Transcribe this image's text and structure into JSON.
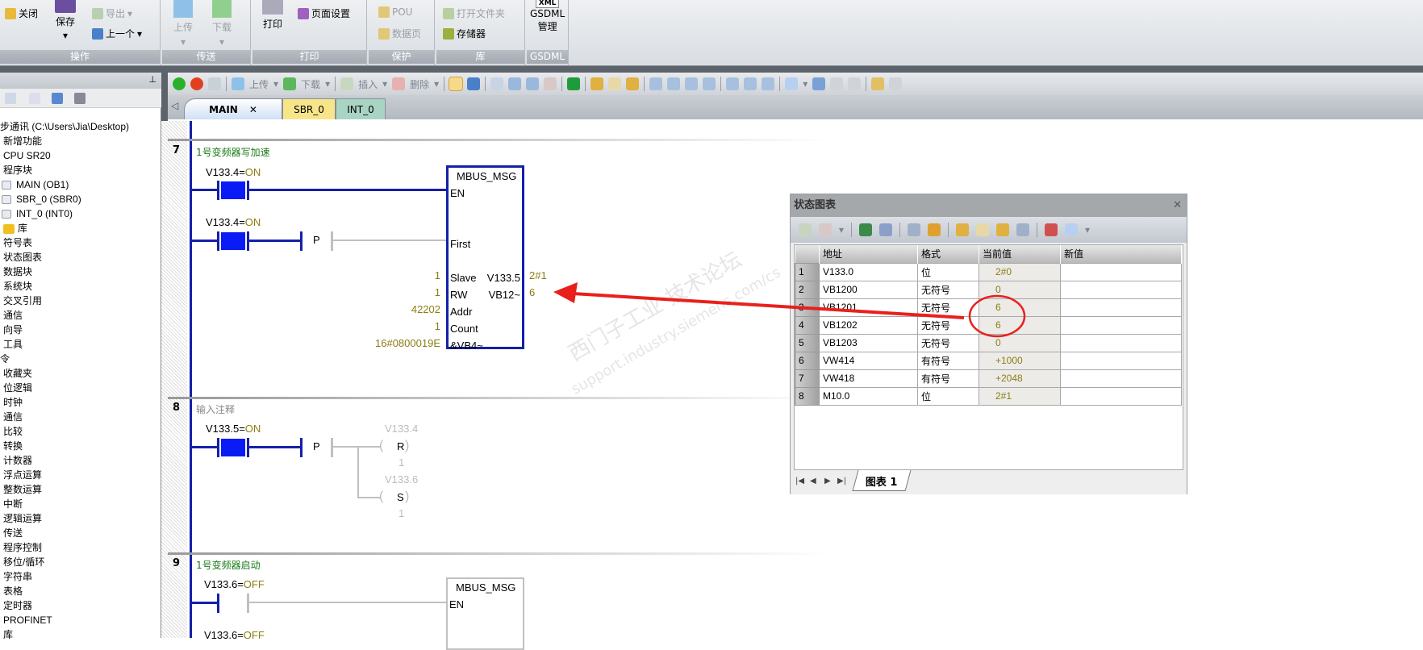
{
  "ribbon": {
    "groups": [
      {
        "label": "操作"
      },
      {
        "label": "传送"
      },
      {
        "label": "打印"
      },
      {
        "label": "保护"
      },
      {
        "label": "库"
      },
      {
        "label": "GSDML"
      }
    ],
    "close": "关闭",
    "save": "保存",
    "export": "导出",
    "previous": "上一个",
    "upload": "上传",
    "download": "下载",
    "print": "打印",
    "page_setup": "页面设置",
    "pou": "POU",
    "data_page": "数据页",
    "open_folder": "打开文件夹",
    "memory": "存储器",
    "gsdml_icon": "XML",
    "gsdml_line1": "GSDML",
    "gsdml_line2": "管理"
  },
  "project_tree": {
    "items": [
      "步通讯 (C:\\Users\\Jia\\Desktop)",
      "新增功能",
      "CPU SR20",
      "程序块",
      "MAIN (OB1)",
      "SBR_0 (SBR0)",
      "INT_0 (INT0)",
      "库",
      "符号表",
      "状态图表",
      "数据块",
      "系统块",
      "交叉引用",
      "通信",
      "向导",
      "工具",
      "令",
      "收藏夹",
      "位逻辑",
      "时钟",
      "通信",
      "比较",
      "转换",
      "计数器",
      "浮点运算",
      "整数运算",
      "中断",
      "逻辑运算",
      "传送",
      "程序控制",
      "移位/循环",
      "字符串",
      "表格",
      "定时器",
      "PROFINET",
      "库"
    ]
  },
  "editor_toolbar": {
    "upload": "上传",
    "download": "下载",
    "insert": "插入",
    "delete": "删除"
  },
  "tabs": [
    {
      "label": "MAIN",
      "active": true,
      "color": "#cfe0f5"
    },
    {
      "label": "SBR_0",
      "color": "#f7e58a"
    },
    {
      "label": "INT_0",
      "color": "#a9d4c4"
    }
  ],
  "networks": [
    {
      "number": "7",
      "comment": "1号变频器写加速",
      "contact1": {
        "addr": "V133.4=",
        "state": "ON"
      },
      "contact2": {
        "addr": "V133.4=",
        "state": "ON"
      },
      "edge": "P",
      "box": {
        "name": "MBUS_MSG",
        "pins": [
          "EN",
          "First",
          "Slave",
          "RW",
          "Addr",
          "Count",
          "&VB4~"
        ],
        "inputs": [
          "1",
          "1",
          "42202",
          "1",
          "16#0800019E"
        ],
        "outputs": [
          {
            "pin": "V133.5",
            "value": "2#1"
          },
          {
            "pin": "VB12~",
            "value": "6"
          }
        ]
      }
    },
    {
      "number": "8",
      "comment": "输入注释",
      "contact1": {
        "addr": "V133.5=",
        "state": "ON"
      },
      "edge": "P",
      "coils": [
        {
          "addr": "V133.4",
          "type": "R",
          "n": "1"
        },
        {
          "addr": "V133.6",
          "type": "S",
          "n": "1"
        }
      ]
    },
    {
      "number": "9",
      "comment": "1号变频器启动",
      "contact1": {
        "addr": "V133.6=",
        "state": "OFF"
      },
      "contact2": {
        "addr": "V133.6=",
        "state": "OFF"
      },
      "box": {
        "name": "MBUS_MSG",
        "pin": "EN"
      }
    }
  ],
  "status_chart": {
    "title": "状态图表",
    "columns": [
      "地址",
      "格式",
      "当前值",
      "新值"
    ],
    "rows": [
      {
        "n": "1",
        "addr": "V133.0",
        "fmt": "位",
        "cur": "2#0",
        "new": ""
      },
      {
        "n": "2",
        "addr": "VB1200",
        "fmt": "无符号",
        "cur": "0",
        "new": ""
      },
      {
        "n": "3",
        "addr": "VB1201",
        "fmt": "无符号",
        "cur": "6",
        "new": ""
      },
      {
        "n": "4",
        "addr": "VB1202",
        "fmt": "无符号",
        "cur": "6",
        "new": ""
      },
      {
        "n": "5",
        "addr": "VB1203",
        "fmt": "无符号",
        "cur": "0",
        "new": ""
      },
      {
        "n": "6",
        "addr": "VW414",
        "fmt": "有符号",
        "cur": "+1000",
        "new": ""
      },
      {
        "n": "7",
        "addr": "VW418",
        "fmt": "有符号",
        "cur": "+2048",
        "new": ""
      },
      {
        "n": "8",
        "addr": "M10.0",
        "fmt": "位",
        "cur": "2#1",
        "new": ""
      }
    ],
    "sheet_tab": "图表 1"
  },
  "watermark": {
    "line1": "西门子工业 技术论坛",
    "line2": "support.industry.siemens.com/cs"
  },
  "colors": {
    "annotation": "#e8201c",
    "energized": "#1420a8",
    "value": "#8c7d12"
  }
}
